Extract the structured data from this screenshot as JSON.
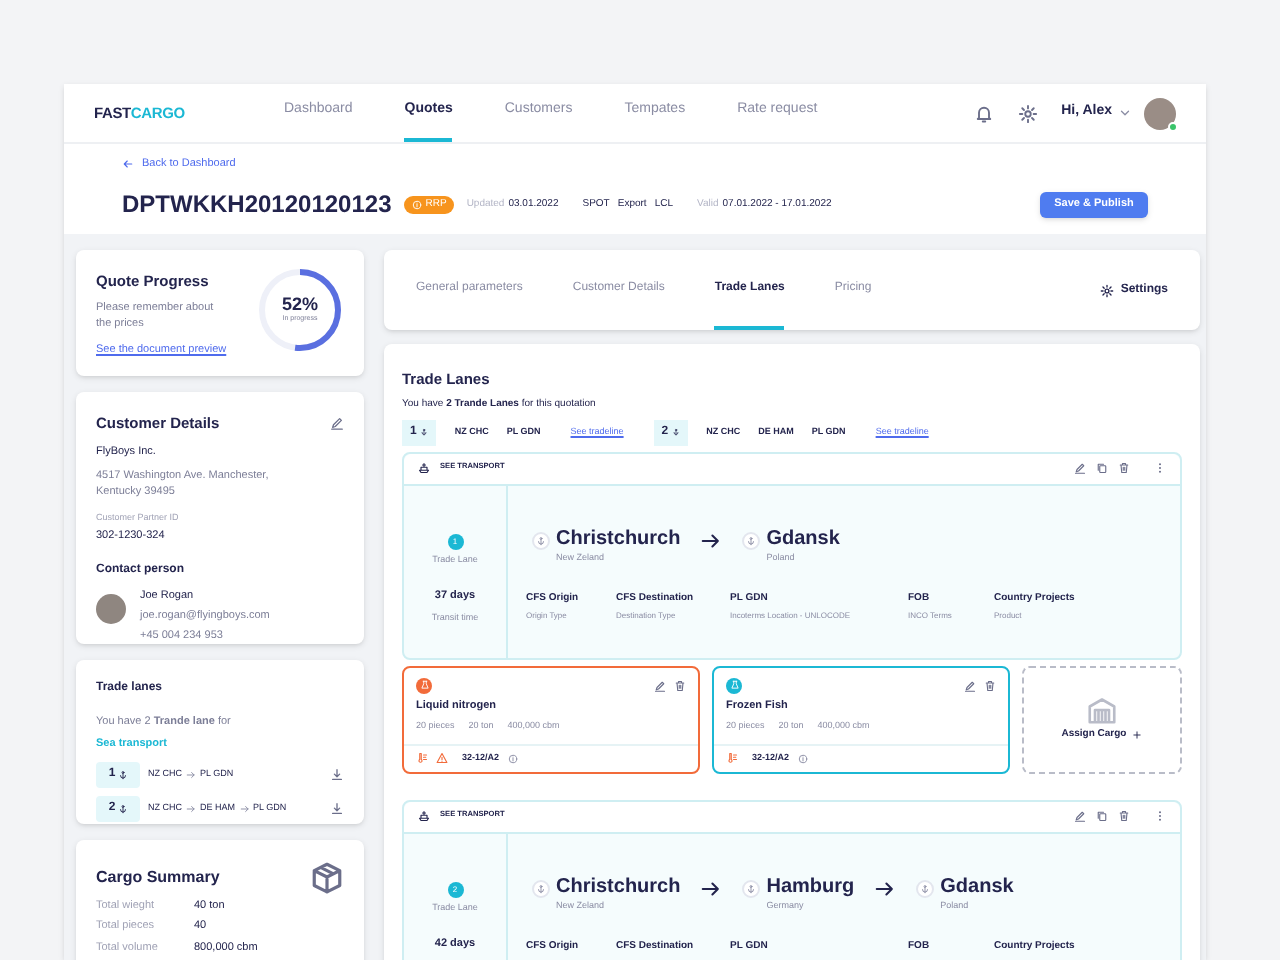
{
  "nav": {
    "logo": [
      "FAST",
      "CARGO"
    ],
    "items": [
      {
        "label": "Dashboard",
        "selected": false
      },
      {
        "label": "Quotes",
        "selected": true
      },
      {
        "label": "Customers",
        "selected": false
      },
      {
        "label": "Tempates",
        "selected": false
      },
      {
        "label": "Rate request",
        "selected": false
      }
    ],
    "user": "Hi, Alex"
  },
  "header": {
    "back": "Back to Dashboard",
    "quote_id": "DPTWKKH20120120123",
    "badge": "RRP",
    "updated_label": "Updated",
    "updated": "03.01.2022",
    "tags": [
      "SPOT",
      "Export",
      "LCL"
    ],
    "valid_label": "Valid",
    "valid": "07.01.2022 - 17.01.2022",
    "button": "Save & Publish"
  },
  "quote_progress": {
    "title": "Quote Progress",
    "note": "Please remember about the prices",
    "link": "See the document preview",
    "percent": "52%",
    "caption": "In progress",
    "level": 0.52
  },
  "customer_details": {
    "title": "Customer Details",
    "company": "FlyBoys Inc.",
    "address": "4517 Washington Ave. Manchester, Kentucky 39495",
    "partner_id_label": "Customer Partner ID",
    "partner_id": "302-1230-324",
    "contact_title": "Contact person",
    "contact": {
      "name": "Joe Rogan",
      "email": "joe.rogan@flyingboys.com",
      "phone": "+45 004 234 953"
    }
  },
  "trade_lanes_summary": {
    "title": "Trade lanes",
    "text": "You have 2 **Trande lane** for",
    "link": "Sea transport",
    "lanes": [
      {
        "number": "1",
        "route": [
          "NZ CHC",
          "PL GDN"
        ]
      },
      {
        "number": "2",
        "route": [
          "NZ CHC",
          "DE HAM",
          "PL GDN"
        ]
      }
    ]
  },
  "cargo_summary": {
    "title": "Cargo Summary",
    "rows": [
      {
        "label": "Total wieght",
        "value": "40 ton"
      },
      {
        "label": "Total pieces",
        "value": "40"
      },
      {
        "label": "Total volume",
        "value": "800,000 cbm"
      }
    ]
  },
  "tabs": [
    {
      "label": "General parameters",
      "selected": false
    },
    {
      "label": "Customer Details",
      "selected": false
    },
    {
      "label": "Trade Lanes",
      "selected": true
    },
    {
      "label": "Pricing",
      "selected": false
    }
  ],
  "settings": "Settings",
  "trade_lanes": {
    "title": "Trade Lanes",
    "text": "You have **2 Trande Lanes** for this quotation",
    "chips": [
      {
        "number": "1",
        "codes": [
          "NZ CHC",
          "PL GDN"
        ],
        "link": "See tradeline"
      },
      {
        "number": "2",
        "codes": [
          "NZ CHC",
          "DE HAM",
          "PL GDN"
        ],
        "link": "See tradeline"
      }
    ],
    "lanes": [
      {
        "transport": "SEE TRANSPORT",
        "number": "1",
        "lane_label": "Trade Lane",
        "days": "37 days",
        "days_label": "Transit time",
        "stops": [
          {
            "city": "Christchurch",
            "country": "New Zeland"
          },
          {
            "city": "Gdansk",
            "country": "Poland"
          }
        ],
        "fields": [
          {
            "value": "CFS Origin",
            "label": "Origin Type"
          },
          {
            "value": "CFS Destination",
            "label": "Destination Type"
          },
          {
            "value": "PL GDN",
            "label": "Incoterms Location - UNLOCODE"
          },
          {
            "value": "FOB",
            "label": "INCO Terms"
          },
          {
            "value": "Country Projects",
            "label": "Product"
          }
        ],
        "cargo": [
          {
            "kind": "cargo",
            "name": "Liquid nitrogen",
            "color": "#f26b3a",
            "warning": true,
            "pieces": "20 pieces",
            "weight": "20 ton",
            "volume": "400,000 cbm",
            "code": "32-12/A2"
          },
          {
            "kind": "cargo",
            "name": "Frozen Fish",
            "color": "#1bb8d4",
            "warning": false,
            "pieces": "20 pieces",
            "weight": "20 ton",
            "volume": "400,000 cbm",
            "code": "32-12/A2"
          },
          {
            "kind": "assign",
            "label": "Assign Cargo"
          }
        ]
      },
      {
        "transport": "SEE TRANSPORT",
        "number": "2",
        "lane_label": "Trade Lane",
        "days": "42 days",
        "stops": [
          {
            "city": "Christchurch",
            "country": "New Zeland"
          },
          {
            "city": "Hamburg",
            "country": "Germany"
          },
          {
            "city": "Gdansk",
            "country": "Poland"
          }
        ],
        "fields": [
          {
            "value": "CFS Origin"
          },
          {
            "value": "CFS Destination"
          },
          {
            "value": "PL GDN"
          },
          {
            "value": "FOB"
          },
          {
            "value": "Country Projects"
          }
        ]
      }
    ]
  }
}
